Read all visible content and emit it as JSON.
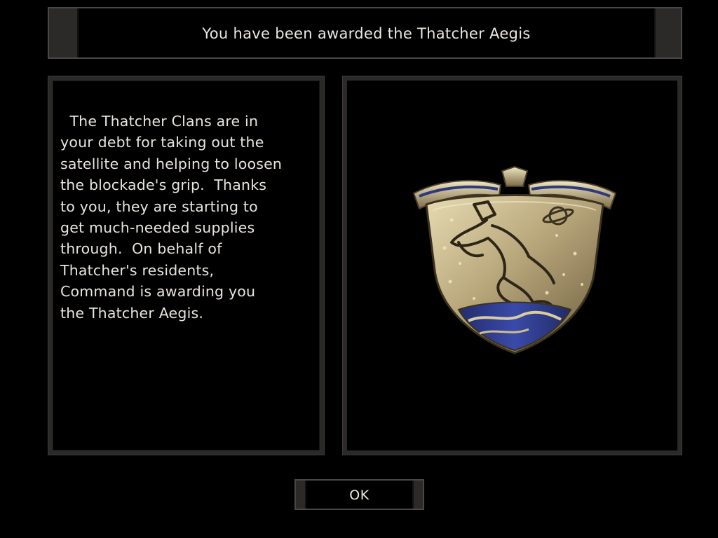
{
  "dialog": {
    "title": "You have been awarded the Thatcher Aegis",
    "message": "  The Thatcher Clans are in\nyour debt for taking out the\nsatellite and helping to loosen\nthe blockade's grip.  Thanks\nto you, they are starting to\nget much-needed supplies\nthrough.  On behalf of\nThatcher's residents,\nCommand is awarding you\nthe Thatcher Aegis.",
    "ok_label": "OK",
    "medal_icon": "thatcher-aegis-medal"
  },
  "colors": {
    "background": "#000000",
    "frame": "#2c2a29",
    "text": "#ebe7e2",
    "medal_gold": "#b8a67a",
    "medal_blue": "#2c3a8c"
  }
}
